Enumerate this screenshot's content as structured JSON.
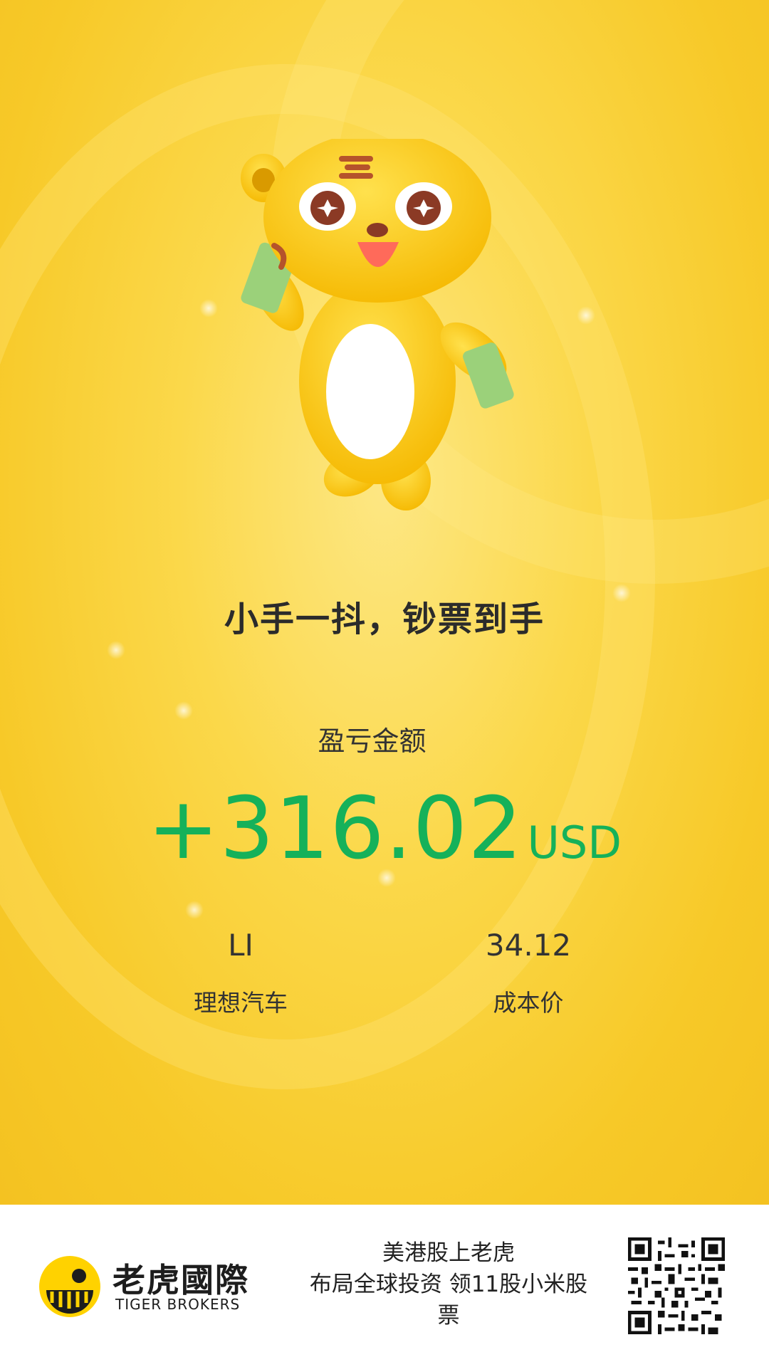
{
  "share_card": {
    "slogan": "小手一抖，钞票到手",
    "pl_label": "盈亏金额",
    "pl_amount": "+316.02",
    "pl_currency": "USD",
    "symbol": "LI",
    "company_name": "理想汽车",
    "cost_price": "34.12",
    "cost_price_label": "成本价",
    "profit_color": "#15b15a",
    "background_color": "#f7c928"
  },
  "footer": {
    "brand_cn": "老虎國際",
    "brand_en": "TIGER BROKERS",
    "promo_lines": [
      "美港股上老虎",
      "布局全球投资 领11股小米股",
      "票"
    ],
    "logo_icon": "tiger-logo-icon",
    "qr_icon": "qr-code-icon"
  }
}
